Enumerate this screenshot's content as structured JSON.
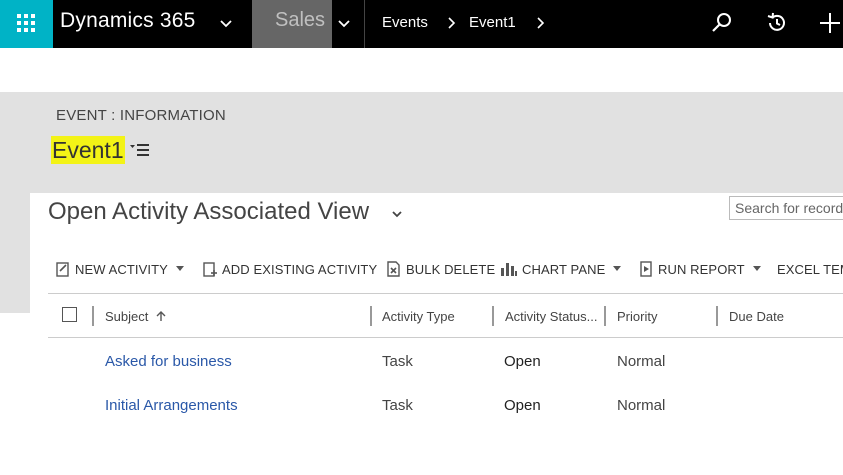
{
  "nav": {
    "brand": "Dynamics 365",
    "app": "Sales",
    "breadcrumb": [
      "Events",
      "Event1"
    ]
  },
  "header": {
    "form_type": "EVENT : INFORMATION",
    "record_name": "Event1"
  },
  "view": {
    "title": "Open Activity Associated View",
    "search_placeholder": "Search for records"
  },
  "commands": [
    {
      "label": "NEW ACTIVITY"
    },
    {
      "label": "ADD EXISTING ACTIVITY"
    },
    {
      "label": "BULK DELETE"
    },
    {
      "label": "CHART PANE"
    },
    {
      "label": "RUN REPORT"
    },
    {
      "label": "EXCEL TEMPLATES"
    }
  ],
  "grid": {
    "columns": [
      "Subject",
      "Activity Type",
      "Activity Status...",
      "Priority",
      "Due Date"
    ],
    "rows": [
      {
        "subject": "Asked for business",
        "type": "Task",
        "status": "Open",
        "priority": "Normal",
        "due": ""
      },
      {
        "subject": "Initial Arrangements",
        "type": "Task",
        "status": "Open",
        "priority": "Normal",
        "due": ""
      }
    ]
  },
  "colors": {
    "waffle": "#00b3c6",
    "topbar": "#000000",
    "app_area": "#666666",
    "highlight": "#f3f316",
    "link": "#2a58a8"
  }
}
